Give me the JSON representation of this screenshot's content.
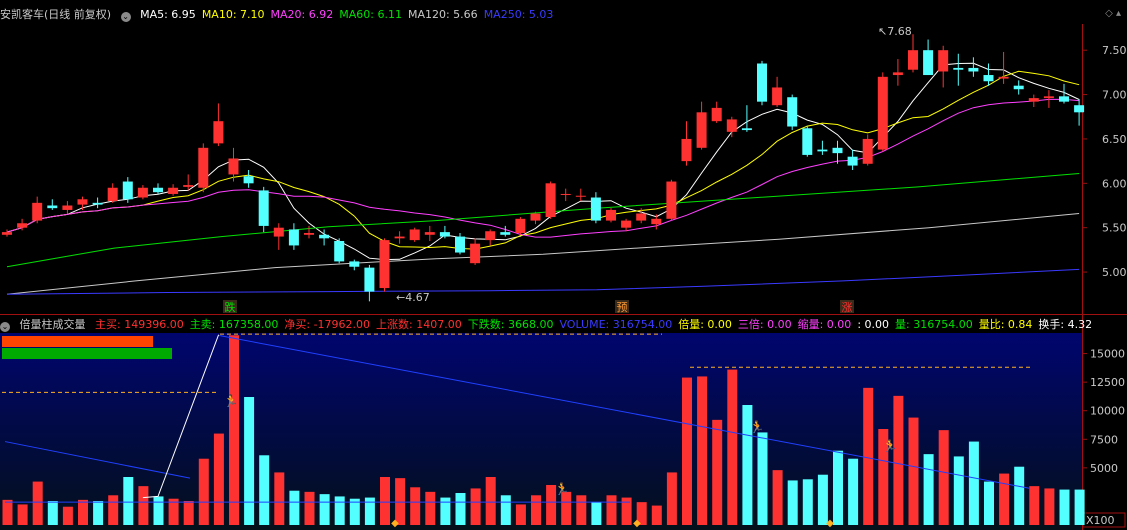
{
  "main_header": {
    "title": "安凯客车(日线 前复权)",
    "ma_labels": [
      {
        "text": "MA5: 6.95",
        "color": "#ffffff"
      },
      {
        "text": "MA10: 7.10",
        "color": "#ffff00"
      },
      {
        "text": "MA20: 6.92",
        "color": "#ff40ff"
      },
      {
        "text": "MA60: 6.11",
        "color": "#00e000"
      },
      {
        "text": "MA120: 5.66",
        "color": "#c8c8c8"
      },
      {
        "text": "MA250: 5.03",
        "color": "#3a3aff"
      }
    ]
  },
  "volume_header": {
    "title": "倍量柱成交量",
    "fields": [
      {
        "text": "主买: 149396.00",
        "color": "#ff3030"
      },
      {
        "text": "主卖: 167358.00",
        "color": "#00e000"
      },
      {
        "text": "净买: -17962.00",
        "color": "#ff3030"
      },
      {
        "text": "上涨数: 1407.00",
        "color": "#ff3030"
      },
      {
        "text": "下跌数: 3668.00",
        "color": "#00e000"
      },
      {
        "text": "VOLUME: 316754.00",
        "color": "#3a3aff"
      },
      {
        "text": "倍量: 0.00",
        "color": "#ffff00"
      },
      {
        "text": "三倍: 0.00",
        "color": "#ff40ff"
      },
      {
        "text": "缩量: 0.00",
        "color": "#ff40ff"
      },
      {
        "text": ": 0.00",
        "color": "#ffffff"
      },
      {
        "text": "量: 316754.00",
        "color": "#00e000"
      },
      {
        "text": "量比: 0.84",
        "color": "#ffff00"
      },
      {
        "text": "换手: 4.32",
        "color": "#ffffff"
      }
    ]
  },
  "price_axis": {
    "ticks": [
      "7.50",
      "7.00",
      "6.50",
      "6.00",
      "5.50",
      "5.00"
    ]
  },
  "volume_axis": {
    "ticks": [
      "15000",
      "12500",
      "10000",
      "7500",
      "5000"
    ],
    "multiplier": "X100"
  },
  "annotations": {
    "high": "7.68",
    "low": "4.67",
    "markers": [
      {
        "text": "跌",
        "color": "#00e000"
      },
      {
        "text": "预",
        "color": "#ff9933"
      },
      {
        "text": "涨",
        "color": "#ff3030"
      }
    ]
  },
  "chart_data": {
    "type": "candlestick",
    "candles": [
      {
        "o": 5.42,
        "h": 5.48,
        "l": 5.4,
        "c": 5.45
      },
      {
        "o": 5.5,
        "h": 5.6,
        "l": 5.47,
        "c": 5.55
      },
      {
        "o": 5.58,
        "h": 5.85,
        "l": 5.55,
        "c": 5.78
      },
      {
        "o": 5.75,
        "h": 5.82,
        "l": 5.7,
        "c": 5.72
      },
      {
        "o": 5.7,
        "h": 5.8,
        "l": 5.66,
        "c": 5.75
      },
      {
        "o": 5.76,
        "h": 5.85,
        "l": 5.7,
        "c": 5.82
      },
      {
        "o": 5.78,
        "h": 5.84,
        "l": 5.72,
        "c": 5.76
      },
      {
        "o": 5.8,
        "h": 6.0,
        "l": 5.78,
        "c": 5.95
      },
      {
        "o": 6.02,
        "h": 6.07,
        "l": 5.78,
        "c": 5.82
      },
      {
        "o": 5.84,
        "h": 5.98,
        "l": 5.82,
        "c": 5.95
      },
      {
        "o": 5.95,
        "h": 6.0,
        "l": 5.88,
        "c": 5.9
      },
      {
        "o": 5.88,
        "h": 5.99,
        "l": 5.86,
        "c": 5.95
      },
      {
        "o": 5.96,
        "h": 6.1,
        "l": 5.92,
        "c": 5.98
      },
      {
        "o": 5.95,
        "h": 6.45,
        "l": 5.9,
        "c": 6.4
      },
      {
        "o": 6.45,
        "h": 6.9,
        "l": 6.42,
        "c": 6.7
      },
      {
        "o": 6.1,
        "h": 6.4,
        "l": 6.02,
        "c": 6.28
      },
      {
        "o": 6.08,
        "h": 6.15,
        "l": 5.95,
        "c": 6.0
      },
      {
        "o": 5.92,
        "h": 5.96,
        "l": 5.45,
        "c": 5.52
      },
      {
        "o": 5.4,
        "h": 5.55,
        "l": 5.25,
        "c": 5.5
      },
      {
        "o": 5.48,
        "h": 5.55,
        "l": 5.25,
        "c": 5.3
      },
      {
        "o": 5.42,
        "h": 5.52,
        "l": 5.38,
        "c": 5.44
      },
      {
        "o": 5.42,
        "h": 5.48,
        "l": 5.3,
        "c": 5.38
      },
      {
        "o": 5.35,
        "h": 5.38,
        "l": 5.1,
        "c": 5.12
      },
      {
        "o": 5.12,
        "h": 5.14,
        "l": 5.02,
        "c": 5.06
      },
      {
        "o": 5.05,
        "h": 5.08,
        "l": 4.67,
        "c": 4.78
      },
      {
        "o": 4.82,
        "h": 5.38,
        "l": 4.78,
        "c": 5.36
      },
      {
        "o": 5.38,
        "h": 5.46,
        "l": 5.32,
        "c": 5.4
      },
      {
        "o": 5.36,
        "h": 5.5,
        "l": 5.34,
        "c": 5.48
      },
      {
        "o": 5.42,
        "h": 5.52,
        "l": 5.35,
        "c": 5.45
      },
      {
        "o": 5.45,
        "h": 5.52,
        "l": 5.38,
        "c": 5.4
      },
      {
        "o": 5.4,
        "h": 5.44,
        "l": 5.2,
        "c": 5.22
      },
      {
        "o": 5.1,
        "h": 5.38,
        "l": 5.08,
        "c": 5.32
      },
      {
        "o": 5.36,
        "h": 5.48,
        "l": 5.3,
        "c": 5.46
      },
      {
        "o": 5.45,
        "h": 5.52,
        "l": 5.4,
        "c": 5.42
      },
      {
        "o": 5.44,
        "h": 5.62,
        "l": 5.42,
        "c": 5.6
      },
      {
        "o": 5.58,
        "h": 5.68,
        "l": 5.54,
        "c": 5.66
      },
      {
        "o": 5.62,
        "h": 6.02,
        "l": 5.6,
        "c": 6.0
      },
      {
        "o": 5.88,
        "h": 5.94,
        "l": 5.8,
        "c": 5.88
      },
      {
        "o": 5.86,
        "h": 5.94,
        "l": 5.8,
        "c": 5.86
      },
      {
        "o": 5.84,
        "h": 5.9,
        "l": 5.55,
        "c": 5.58
      },
      {
        "o": 5.58,
        "h": 5.72,
        "l": 5.56,
        "c": 5.7
      },
      {
        "o": 5.5,
        "h": 5.6,
        "l": 5.46,
        "c": 5.58
      },
      {
        "o": 5.58,
        "h": 5.72,
        "l": 5.55,
        "c": 5.66
      },
      {
        "o": 5.54,
        "h": 5.65,
        "l": 5.48,
        "c": 5.6
      },
      {
        "o": 5.6,
        "h": 6.04,
        "l": 5.58,
        "c": 6.02
      },
      {
        "o": 6.25,
        "h": 6.7,
        "l": 6.2,
        "c": 6.5
      },
      {
        "o": 6.4,
        "h": 6.92,
        "l": 6.38,
        "c": 6.8
      },
      {
        "o": 6.7,
        "h": 6.92,
        "l": 6.68,
        "c": 6.85
      },
      {
        "o": 6.58,
        "h": 6.75,
        "l": 6.52,
        "c": 6.72
      },
      {
        "o": 6.62,
        "h": 6.88,
        "l": 6.58,
        "c": 6.6
      },
      {
        "o": 7.35,
        "h": 7.38,
        "l": 6.88,
        "c": 6.92
      },
      {
        "o": 6.88,
        "h": 7.2,
        "l": 6.86,
        "c": 7.08
      },
      {
        "o": 6.97,
        "h": 7.0,
        "l": 6.6,
        "c": 6.64
      },
      {
        "o": 6.62,
        "h": 6.65,
        "l": 6.3,
        "c": 6.32
      },
      {
        "o": 6.38,
        "h": 6.48,
        "l": 6.32,
        "c": 6.36
      },
      {
        "o": 6.4,
        "h": 6.48,
        "l": 6.22,
        "c": 6.34
      },
      {
        "o": 6.3,
        "h": 6.38,
        "l": 6.15,
        "c": 6.2
      },
      {
        "o": 6.22,
        "h": 6.55,
        "l": 6.2,
        "c": 6.5
      },
      {
        "o": 6.38,
        "h": 7.25,
        "l": 6.36,
        "c": 7.2
      },
      {
        "o": 7.22,
        "h": 7.4,
        "l": 7.1,
        "c": 7.25
      },
      {
        "o": 7.28,
        "h": 7.68,
        "l": 7.25,
        "c": 7.5
      },
      {
        "o": 7.5,
        "h": 7.62,
        "l": 7.22,
        "c": 7.22
      },
      {
        "o": 7.26,
        "h": 7.55,
        "l": 7.08,
        "c": 7.5
      },
      {
        "o": 7.3,
        "h": 7.46,
        "l": 7.1,
        "c": 7.28
      },
      {
        "o": 7.3,
        "h": 7.42,
        "l": 7.2,
        "c": 7.26
      },
      {
        "o": 7.22,
        "h": 7.35,
        "l": 7.1,
        "c": 7.15
      },
      {
        "o": 7.18,
        "h": 7.48,
        "l": 7.12,
        "c": 7.2
      },
      {
        "o": 7.1,
        "h": 7.16,
        "l": 7.0,
        "c": 7.06
      },
      {
        "o": 6.92,
        "h": 7.0,
        "l": 6.86,
        "c": 6.96
      },
      {
        "o": 6.96,
        "h": 7.05,
        "l": 6.85,
        "c": 6.98
      },
      {
        "o": 6.98,
        "h": 7.12,
        "l": 6.9,
        "c": 6.92
      },
      {
        "o": 6.88,
        "h": 6.95,
        "l": 6.65,
        "c": 6.8
      }
    ],
    "volumes": [
      2200,
      1800,
      3800,
      2100,
      1600,
      2200,
      2100,
      2600,
      4200,
      3400,
      2500,
      2300,
      2100,
      5800,
      8000,
      16600,
      11200,
      6100,
      4600,
      3000,
      2900,
      2700,
      2500,
      2300,
      2400,
      4200,
      4100,
      3300,
      2900,
      2400,
      2800,
      3200,
      4200,
      2600,
      1800,
      2600,
      3500,
      2900,
      2600,
      2000,
      2600,
      2400,
      2000,
      1700,
      4600,
      12900,
      13000,
      9200,
      13600,
      10500,
      8100,
      4800,
      3900,
      4000,
      4400,
      6500,
      5800,
      12000,
      8400,
      11300,
      9400,
      6200,
      8300,
      6000,
      7300,
      3800,
      4500,
      5100,
      3400,
      3200,
      3100,
      3100
    ],
    "moving_averages": [
      {
        "name": "MA5",
        "color": "#ffffff"
      },
      {
        "name": "MA10",
        "color": "#ffff00"
      },
      {
        "name": "MA20",
        "color": "#ff40ff"
      },
      {
        "name": "MA60",
        "color": "#00e000",
        "values": [
          5.06,
          5.27,
          5.4,
          5.51,
          5.58,
          5.72,
          5.84,
          5.96,
          6.11
        ],
        "x_frac": [
          0,
          0.1,
          0.2,
          0.3,
          0.4,
          0.55,
          0.7,
          0.85,
          1
        ]
      },
      {
        "name": "MA120",
        "color": "#c8c8c8",
        "values": [
          4.75,
          4.9,
          5.05,
          5.15,
          5.2,
          5.28,
          5.37,
          5.5,
          5.66
        ],
        "x_frac": [
          0,
          0.12,
          0.25,
          0.4,
          0.5,
          0.6,
          0.72,
          0.86,
          1
        ]
      },
      {
        "name": "MA250",
        "color": "#3a3aff",
        "values": [
          4.75,
          4.77,
          4.78,
          4.79,
          4.8,
          4.84,
          4.9,
          4.97,
          5.03
        ],
        "x_frac": [
          0,
          0.15,
          0.3,
          0.45,
          0.55,
          0.65,
          0.78,
          0.9,
          1
        ]
      }
    ],
    "price_range": [
      4.55,
      7.75
    ],
    "volume_range": [
      0,
      16800
    ]
  }
}
